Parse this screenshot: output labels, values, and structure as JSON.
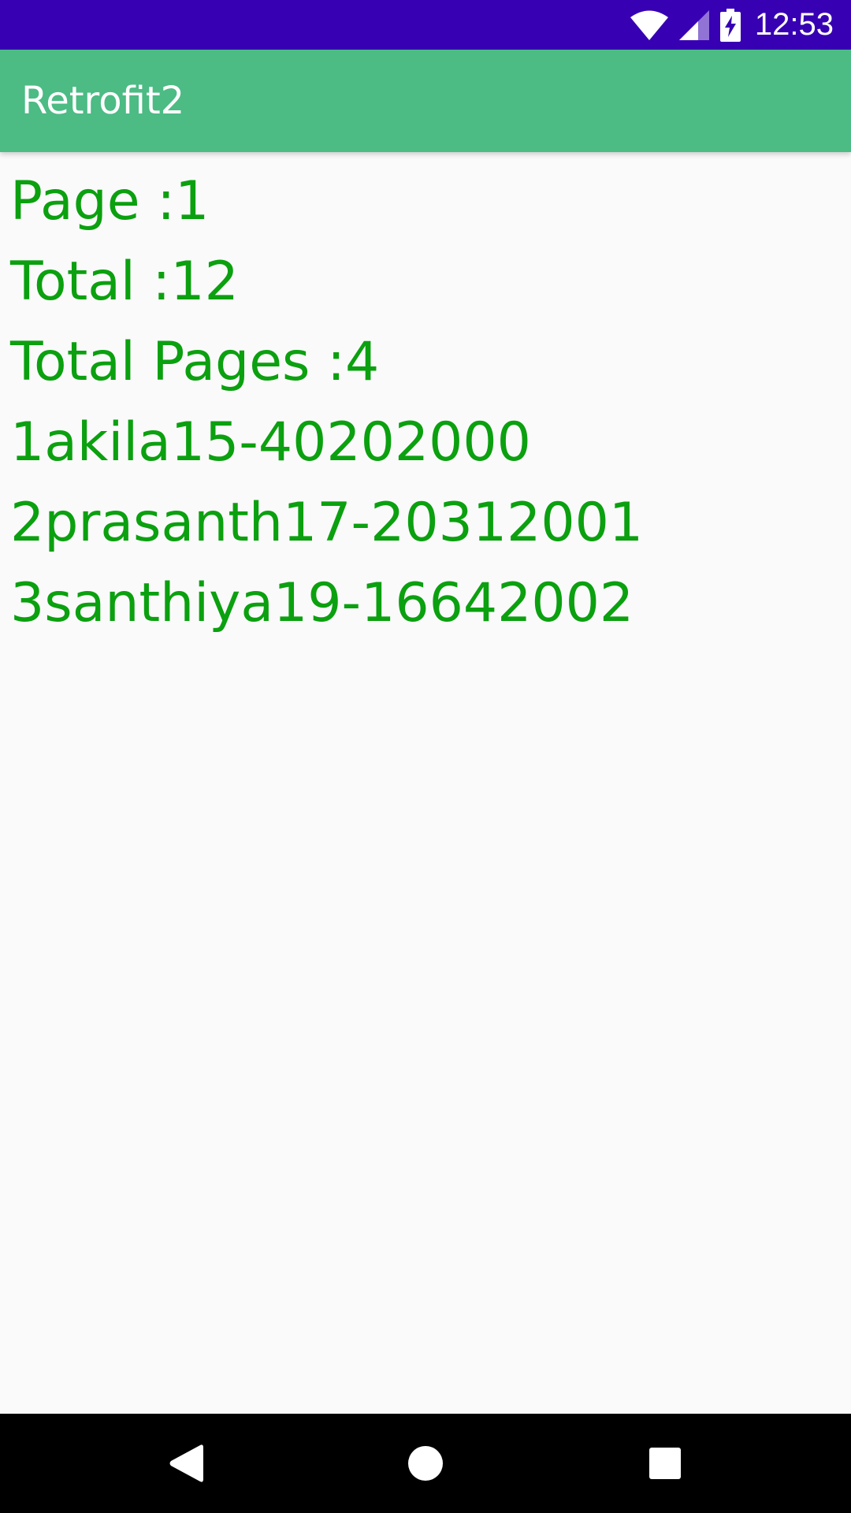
{
  "status_bar": {
    "time": "12:53",
    "icons": [
      "wifi-icon",
      "signal-icon",
      "battery-charging-icon"
    ],
    "background": "#3700b3"
  },
  "app_bar": {
    "title": "Retrofit2",
    "background": "#4cbb84"
  },
  "content": {
    "text_color": "#0ba00f",
    "page_line": "Page :1",
    "total_line": "Total :12",
    "total_pages_line": "Total Pages :4",
    "items": [
      "1akila15-40202000",
      "2prasanth17-20312001",
      "3santhiya19-16642002"
    ]
  },
  "nav_bar": {
    "buttons": [
      "back-icon",
      "home-icon",
      "recents-icon"
    ]
  }
}
